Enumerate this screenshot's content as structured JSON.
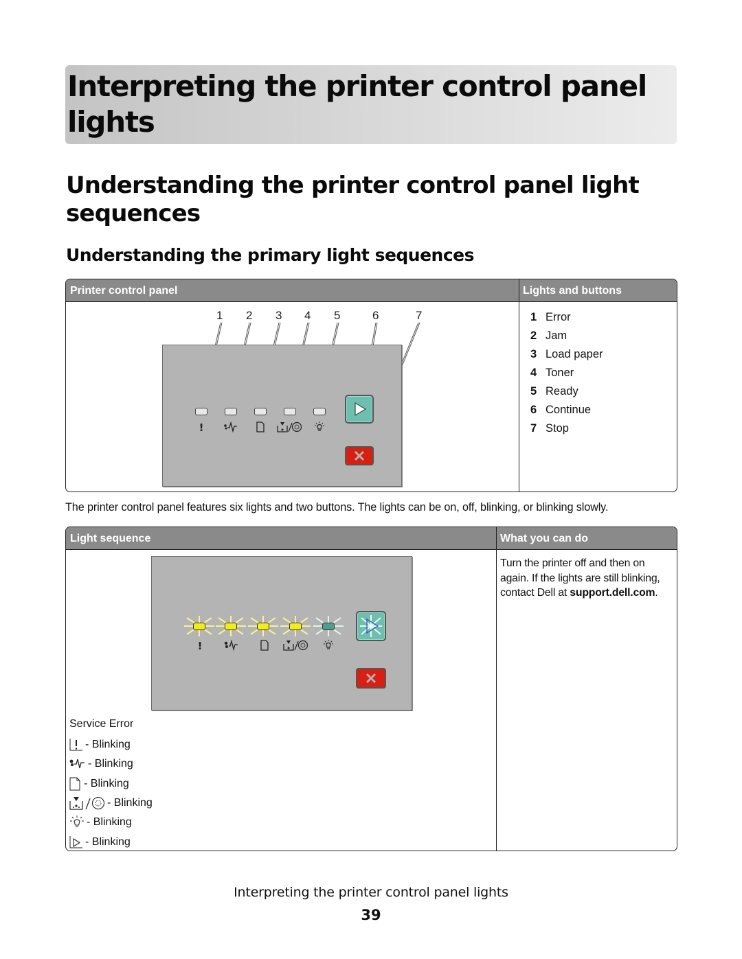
{
  "chapter_title": "Interpreting the printer control panel lights",
  "section_title": "Understanding the printer control panel light sequences",
  "subsection_title": "Understanding the primary light sequences",
  "table1": {
    "headers": [
      "Printer control panel",
      "Lights and buttons"
    ],
    "callouts": [
      "1",
      "2",
      "3",
      "4",
      "5",
      "6",
      "7"
    ],
    "panel_symbols": [
      "!",
      "jam-icon",
      "load-paper-icon",
      "toner-icon",
      "ready-icon"
    ],
    "legend": [
      {
        "num": "1",
        "label": "Error"
      },
      {
        "num": "2",
        "label": "Jam"
      },
      {
        "num": "3",
        "label": "Load paper"
      },
      {
        "num": "4",
        "label": "Toner"
      },
      {
        "num": "5",
        "label": "Ready"
      },
      {
        "num": "6",
        "label": "Continue"
      },
      {
        "num": "7",
        "label": "Stop"
      }
    ]
  },
  "paragraph": "The printer control panel features six lights and two buttons. The lights can be on, off, blinking, or blinking slowly.",
  "table2": {
    "headers": [
      "Light sequence",
      "What you can do"
    ],
    "sequence_title": "Service Error",
    "sequence_items": [
      {
        "icon": "error-icon",
        "state": "- Blinking"
      },
      {
        "icon": "jam-icon",
        "state": "- Blinking"
      },
      {
        "icon": "load-paper-icon",
        "state": "- Blinking"
      },
      {
        "icon": "toner-icon",
        "state": "- Blinking"
      },
      {
        "icon": "ready-icon",
        "state": "- Blinking"
      },
      {
        "icon": "continue-icon",
        "state": "- Blinking"
      }
    ],
    "led_colors": [
      "#f2ec18",
      "#f2ec18",
      "#f2ec18",
      "#f2ec18",
      "#4f9e8c"
    ],
    "action_text_1": "Turn the printer off and then on again. If the lights are still blinking, contact Dell at ",
    "action_link": "support.dell.com",
    "action_text_2": "."
  },
  "footer": {
    "title": "Interpreting the printer control panel lights",
    "page": "39"
  }
}
